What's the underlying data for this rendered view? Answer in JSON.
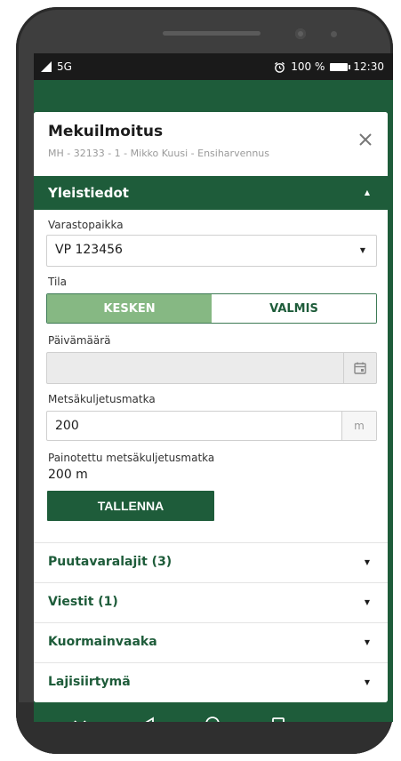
{
  "status_bar": {
    "network": "5G",
    "battery": "100 %",
    "time": "12:30"
  },
  "dialog": {
    "title": "Mekuilmoitus",
    "subtitle": "MH - 32133 - 1 - Mikko Kuusi - Ensiharvennus",
    "section_general": "Yleistiedot",
    "storage_label": "Varastopaikka",
    "storage_value": "VP 123456",
    "state_label": "Tila",
    "state_options": [
      "KESKEN",
      "VALMIS"
    ],
    "state_selected": "KESKEN",
    "date_label": "Päivämäärä",
    "date_value": "",
    "distance_label": "Metsäkuljetusmatka",
    "distance_value": "200",
    "distance_unit": "m",
    "weighted_label": "Painotettu metsäkuljetusmatka",
    "weighted_value": "200 m",
    "save_label": "TALLENNA",
    "sections": [
      "Puutavaralajit (3)",
      "Viestit (1)",
      "Kuormainvaaka",
      "Lajisiirtymä"
    ]
  },
  "icons": [
    "signal-icon",
    "alarm-icon",
    "battery-icon",
    "close-icon",
    "calendar-icon",
    "chevron-down-icon",
    "back-icon",
    "home-icon",
    "recents-icon"
  ],
  "colors": {
    "primary": "#1e5c3a",
    "selected_segment": "#86b883"
  }
}
